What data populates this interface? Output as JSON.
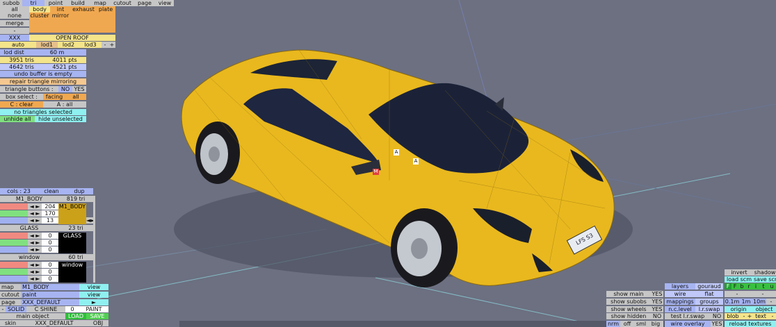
{
  "menu": [
    "subob",
    "tri",
    "point",
    "build",
    "map",
    "cutout",
    "page",
    "view"
  ],
  "menu_active": "tri",
  "select_row1": [
    "all",
    "body",
    "int",
    "exhaust",
    "plate"
  ],
  "select_row2": [
    "none",
    "cluster",
    "mirror"
  ],
  "merge_label": "merge",
  "dash_label": "-",
  "xxx_label": "XXX",
  "open_roof": "OPEN ROOF",
  "lod": [
    "auto",
    "lod1",
    "lod2",
    "lod3",
    "-",
    "+"
  ],
  "lod_dist_label": "lod dist",
  "lod_dist_value": "60 m",
  "tris1": "3951 tris",
  "pts1": "4011 pts",
  "tris2": "4642 tris",
  "pts2": "4521 pts",
  "undo": "undo buffer is empty",
  "repair": "repair triangle mirroring",
  "tri_buttons_label": "triangle buttons :",
  "tri_no": "NO",
  "tri_yes": "YES",
  "box_select_label": "box select :",
  "box_facing": "facing",
  "box_all": "all",
  "c_clear": "C : clear",
  "a_all": "A : all",
  "no_tris": "no triangles selected",
  "unhide_all": "unhide all",
  "hide_unselected": "hide unselected",
  "cols_label": "cols : 23",
  "clean_label": "clean",
  "dup_label": "dup",
  "materials": [
    {
      "name": "M1_BODY",
      "tris": "819 tri",
      "vals": [
        "204",
        "170",
        "13"
      ],
      "swatch": "M1_BODY"
    },
    {
      "name": "GLASS",
      "tris": "23 tri",
      "vals": [
        "0",
        "0",
        "0"
      ],
      "swatch": "GLASS"
    },
    {
      "name": "window",
      "tris": "60 tri",
      "vals": [
        "0",
        "0",
        "0"
      ],
      "swatch": "window"
    }
  ],
  "map_label": "map",
  "map_value": "M1_BODY",
  "view1": "view",
  "cutout_label": "cutout",
  "cutout_value": "paint",
  "view2": "view",
  "page_label": "page",
  "page_value": "XXX_DEFAULT",
  "arrow_right": "►",
  "solid": "SOLID",
  "c_shine": "C SHINE",
  "zero": "0",
  "paint": "PAINT",
  "main_object": "main object",
  "load": "LOAD",
  "save": "SAVE",
  "skin_label": "skin",
  "skin_value": "XXX_DEFAULT",
  "obj": "OBJ",
  "show_main": "show main",
  "show_subobs": "show subobs",
  "show_wheels": "show wheels",
  "show_hidden": "show hidden",
  "yes": "YES",
  "no": "NO",
  "nrm": "nrm",
  "off": "off",
  "sml": "sml",
  "big": "big",
  "layers": "layers",
  "gouraud": "gouraud",
  "wire": "wire",
  "flat": "flat",
  "mappings": "mappings",
  "groups": "groups",
  "nc_level": "n.c.level",
  "lr_swap": "l.r.swap",
  "test_lr_swap": "test l.r.swap",
  "wire_overlay": "wire overlay",
  "invert": "invert",
  "shadow": "shadow",
  "load_scm": "load scm",
  "save_scm": "save scm",
  "letters": [
    "F",
    "F",
    "b",
    "r",
    "i",
    "t",
    "u"
  ],
  "dash": "-",
  "m01": "0.1m",
  "m1": "1m",
  "m10": "10m",
  "origin": "origin",
  "object": "object",
  "blob": "blob",
  "minus": "-",
  "plus": "+",
  "text_label": "text",
  "reload_textures": "reload textures",
  "plate_text": "LFS S3",
  "marker_a1": "A",
  "marker_a2": "A",
  "marker_m": "M"
}
